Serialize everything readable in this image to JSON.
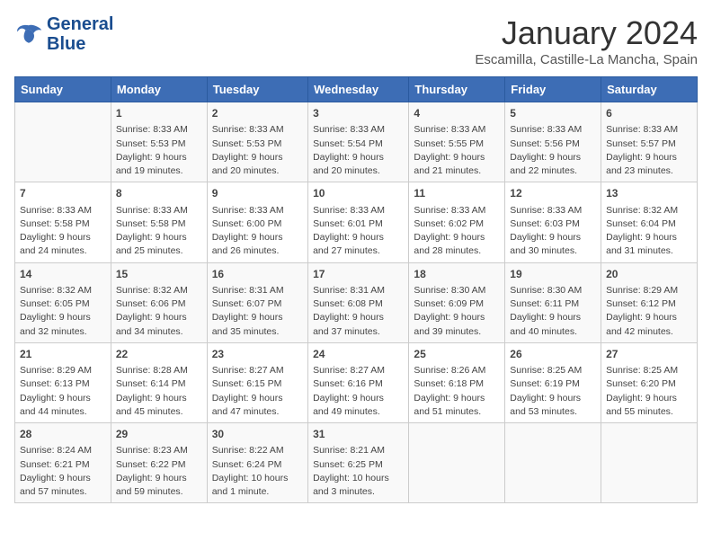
{
  "header": {
    "logo_line1": "General",
    "logo_line2": "Blue",
    "month": "January 2024",
    "location": "Escamilla, Castille-La Mancha, Spain"
  },
  "weekdays": [
    "Sunday",
    "Monday",
    "Tuesday",
    "Wednesday",
    "Thursday",
    "Friday",
    "Saturday"
  ],
  "weeks": [
    [
      {
        "day": "",
        "info": ""
      },
      {
        "day": "1",
        "info": "Sunrise: 8:33 AM\nSunset: 5:53 PM\nDaylight: 9 hours\nand 19 minutes."
      },
      {
        "day": "2",
        "info": "Sunrise: 8:33 AM\nSunset: 5:53 PM\nDaylight: 9 hours\nand 20 minutes."
      },
      {
        "day": "3",
        "info": "Sunrise: 8:33 AM\nSunset: 5:54 PM\nDaylight: 9 hours\nand 20 minutes."
      },
      {
        "day": "4",
        "info": "Sunrise: 8:33 AM\nSunset: 5:55 PM\nDaylight: 9 hours\nand 21 minutes."
      },
      {
        "day": "5",
        "info": "Sunrise: 8:33 AM\nSunset: 5:56 PM\nDaylight: 9 hours\nand 22 minutes."
      },
      {
        "day": "6",
        "info": "Sunrise: 8:33 AM\nSunset: 5:57 PM\nDaylight: 9 hours\nand 23 minutes."
      }
    ],
    [
      {
        "day": "7",
        "info": ""
      },
      {
        "day": "8",
        "info": "Sunrise: 8:33 AM\nSunset: 5:58 PM\nDaylight: 9 hours\nand 25 minutes."
      },
      {
        "day": "9",
        "info": "Sunrise: 8:33 AM\nSunset: 6:00 PM\nDaylight: 9 hours\nand 26 minutes."
      },
      {
        "day": "10",
        "info": "Sunrise: 8:33 AM\nSunset: 6:01 PM\nDaylight: 9 hours\nand 27 minutes."
      },
      {
        "day": "11",
        "info": "Sunrise: 8:33 AM\nSunset: 6:02 PM\nDaylight: 9 hours\nand 28 minutes."
      },
      {
        "day": "12",
        "info": "Sunrise: 8:33 AM\nSunset: 6:03 PM\nDaylight: 9 hours\nand 30 minutes."
      },
      {
        "day": "13",
        "info": "Sunrise: 8:32 AM\nSunset: 6:04 PM\nDaylight: 9 hours\nand 31 minutes."
      }
    ],
    [
      {
        "day": "14",
        "info": ""
      },
      {
        "day": "15",
        "info": "Sunrise: 8:32 AM\nSunset: 6:06 PM\nDaylight: 9 hours\nand 34 minutes."
      },
      {
        "day": "16",
        "info": "Sunrise: 8:31 AM\nSunset: 6:07 PM\nDaylight: 9 hours\nand 35 minutes."
      },
      {
        "day": "17",
        "info": "Sunrise: 8:31 AM\nSunset: 6:08 PM\nDaylight: 9 hours\nand 37 minutes."
      },
      {
        "day": "18",
        "info": "Sunrise: 8:30 AM\nSunset: 6:09 PM\nDaylight: 9 hours\nand 39 minutes."
      },
      {
        "day": "19",
        "info": "Sunrise: 8:30 AM\nSunset: 6:11 PM\nDaylight: 9 hours\nand 40 minutes."
      },
      {
        "day": "20",
        "info": "Sunrise: 8:29 AM\nSunset: 6:12 PM\nDaylight: 9 hours\nand 42 minutes."
      }
    ],
    [
      {
        "day": "21",
        "info": ""
      },
      {
        "day": "22",
        "info": "Sunrise: 8:28 AM\nSunset: 6:14 PM\nDaylight: 9 hours\nand 45 minutes."
      },
      {
        "day": "23",
        "info": "Sunrise: 8:27 AM\nSunset: 6:15 PM\nDaylight: 9 hours\nand 47 minutes."
      },
      {
        "day": "24",
        "info": "Sunrise: 8:27 AM\nSunset: 6:16 PM\nDaylight: 9 hours\nand 49 minutes."
      },
      {
        "day": "25",
        "info": "Sunrise: 8:26 AM\nSunset: 6:18 PM\nDaylight: 9 hours\nand 51 minutes."
      },
      {
        "day": "26",
        "info": "Sunrise: 8:25 AM\nSunset: 6:19 PM\nDaylight: 9 hours\nand 53 minutes."
      },
      {
        "day": "27",
        "info": "Sunrise: 8:25 AM\nSunset: 6:20 PM\nDaylight: 9 hours\nand 55 minutes."
      }
    ],
    [
      {
        "day": "28",
        "info": ""
      },
      {
        "day": "29",
        "info": "Sunrise: 8:23 AM\nSunset: 6:22 PM\nDaylight: 9 hours\nand 59 minutes."
      },
      {
        "day": "30",
        "info": "Sunrise: 8:22 AM\nSunset: 6:24 PM\nDaylight: 10 hours\nand 1 minute."
      },
      {
        "day": "31",
        "info": "Sunrise: 8:21 AM\nSunset: 6:25 PM\nDaylight: 10 hours\nand 3 minutes."
      },
      {
        "day": "",
        "info": ""
      },
      {
        "day": "",
        "info": ""
      },
      {
        "day": "",
        "info": ""
      }
    ]
  ],
  "week0_sun": {
    "day": "7",
    "info": "Sunrise: 8:33 AM\nSunset: 5:58 PM\nDaylight: 9 hours\nand 24 minutes."
  },
  "week1_sun": {
    "day": "14",
    "info": "Sunrise: 8:32 AM\nSunset: 6:05 PM\nDaylight: 9 hours\nand 32 minutes."
  },
  "week2_sun": {
    "day": "21",
    "info": "Sunrise: 8:29 AM\nSunset: 6:13 PM\nDaylight: 9 hours\nand 44 minutes."
  },
  "week3_sun": {
    "day": "28",
    "info": "Sunrise: 8:24 AM\nSunset: 6:21 PM\nDaylight: 9 hours\nand 57 minutes."
  }
}
